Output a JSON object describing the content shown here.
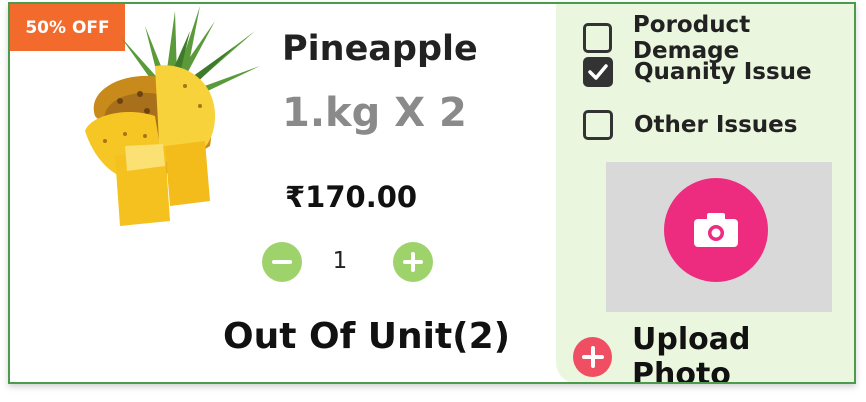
{
  "badge": {
    "label": "50% OFF"
  },
  "product": {
    "name": "Pineapple",
    "weight": "1.kg X 2",
    "price": "₹170.00",
    "quantity": "1",
    "out_of_unit": "Out Of Unit(2)"
  },
  "issues": [
    {
      "label": "Poroduct Demage",
      "checked": false
    },
    {
      "label": "Quanity Issue",
      "checked": true
    },
    {
      "label": "Other Issues",
      "checked": false
    }
  ],
  "upload": {
    "label": "Upload Photo"
  },
  "colors": {
    "badge": "#f26b2d",
    "stepper": "#9ed36b",
    "side_panel": "#eaf6de",
    "camera": "#ee2c7f",
    "add": "#f04e62",
    "border": "#4c9a4c"
  },
  "icons": {
    "product": "pineapple-image",
    "minus": "minus-icon",
    "plus": "plus-icon",
    "check": "check-icon",
    "camera": "camera-icon",
    "add": "add-icon"
  }
}
